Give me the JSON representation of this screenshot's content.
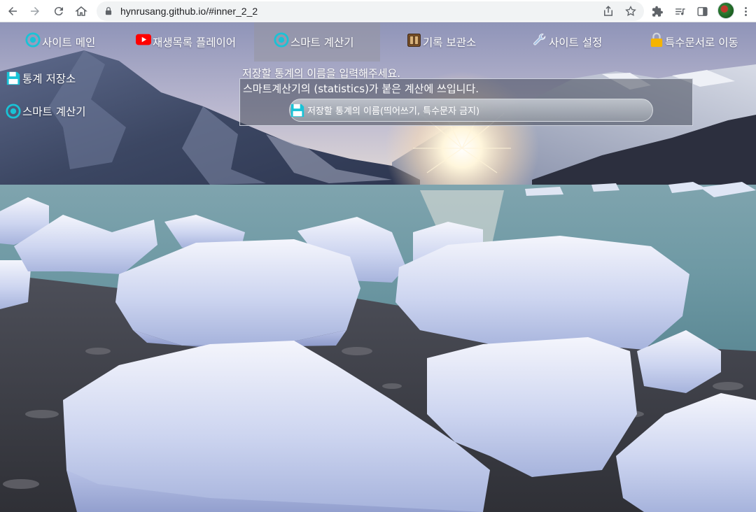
{
  "browser": {
    "url": "hynrusang.github.io/#inner_2_2"
  },
  "topnav": {
    "items": [
      {
        "label": "사이트 메인",
        "icon": "target-icon",
        "active": false
      },
      {
        "label": "재생목록 플레이어",
        "icon": "youtube-icon",
        "active": false
      },
      {
        "label": "스마트 계산기",
        "icon": "target-icon",
        "active": true
      },
      {
        "label": "기록 보관소",
        "icon": "cabinet-icon",
        "active": false
      },
      {
        "label": "사이트 설정",
        "icon": "wrench-icon",
        "active": false
      },
      {
        "label": "특수문서로 이동",
        "icon": "lock-icon",
        "active": false
      }
    ]
  },
  "sidebar": {
    "items": [
      {
        "label": "통계 저장소",
        "icon": "floppy-disk-icon"
      },
      {
        "label": "스마트 계산기",
        "icon": "target-icon"
      }
    ]
  },
  "form": {
    "prompt": "저장할 통계의 이름을 입력해주세요.",
    "description": "스마트계산기의 (statistics)가 붙은 계산에 쓰입니다.",
    "input_placeholder": "저장할 통계의 이름(띄어쓰기, 특수문자 금지)",
    "input_value": ""
  },
  "colors": {
    "accent_cyan": "#19c3d6",
    "youtube_red": "#ff0000",
    "text": "#ffffff"
  }
}
